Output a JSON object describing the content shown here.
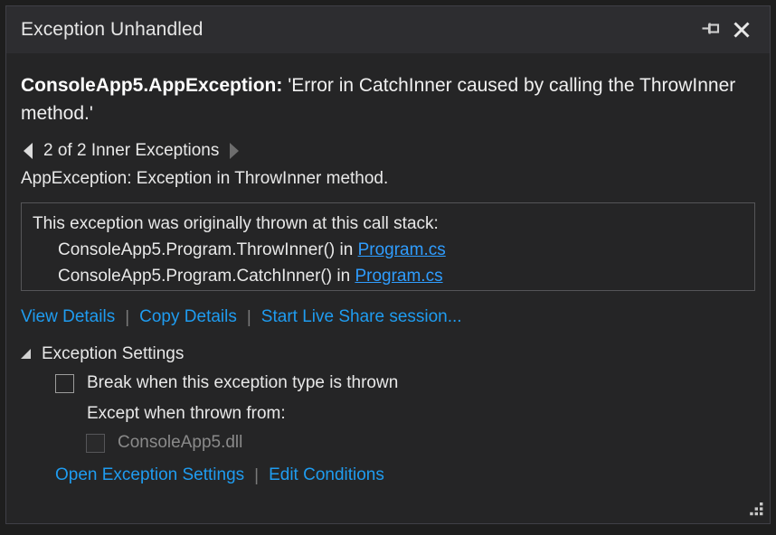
{
  "window": {
    "title": "Exception Unhandled",
    "pin_icon": "pin-icon",
    "close_icon": "close-icon",
    "resize_grip_icon": "resize-grip-icon"
  },
  "exception": {
    "type": "ConsoleApp5.AppException:",
    "message": "'Error in CatchInner caused by calling the ThrowInner method.'"
  },
  "inner_exceptions": {
    "prev_arrow_icon": "triangle-left-icon",
    "next_arrow_icon": "triangle-right-icon",
    "counter_label": "2 of 2 Inner Exceptions",
    "description": "AppException: Exception in ThrowInner method."
  },
  "call_stack": {
    "title": "This exception was originally thrown at this call stack:",
    "frames": [
      {
        "method": "ConsoleApp5.Program.ThrowInner() in ",
        "file": "Program.cs"
      },
      {
        "method": "ConsoleApp5.Program.CatchInner() in ",
        "file": "Program.cs"
      }
    ]
  },
  "actions": {
    "view_details": "View Details",
    "copy_details": "Copy Details",
    "start_live_share": "Start Live Share session...",
    "separator": "|"
  },
  "settings": {
    "header": "Exception Settings",
    "expander_icon": "expander-expanded-icon",
    "break_when_thrown": "Break when this exception type is thrown",
    "except_when_label": "Except when thrown from:",
    "module": "ConsoleApp5.dll",
    "open_exception_settings": "Open Exception Settings",
    "edit_conditions": "Edit Conditions",
    "separator": "|"
  },
  "colors": {
    "link": "#1f9cf0",
    "window_bg": "#252526",
    "titlebar_bg": "#2d2d30",
    "border": "#3f3f46",
    "text": "#e8e8e8",
    "disabled_text": "#8a8a8a"
  }
}
